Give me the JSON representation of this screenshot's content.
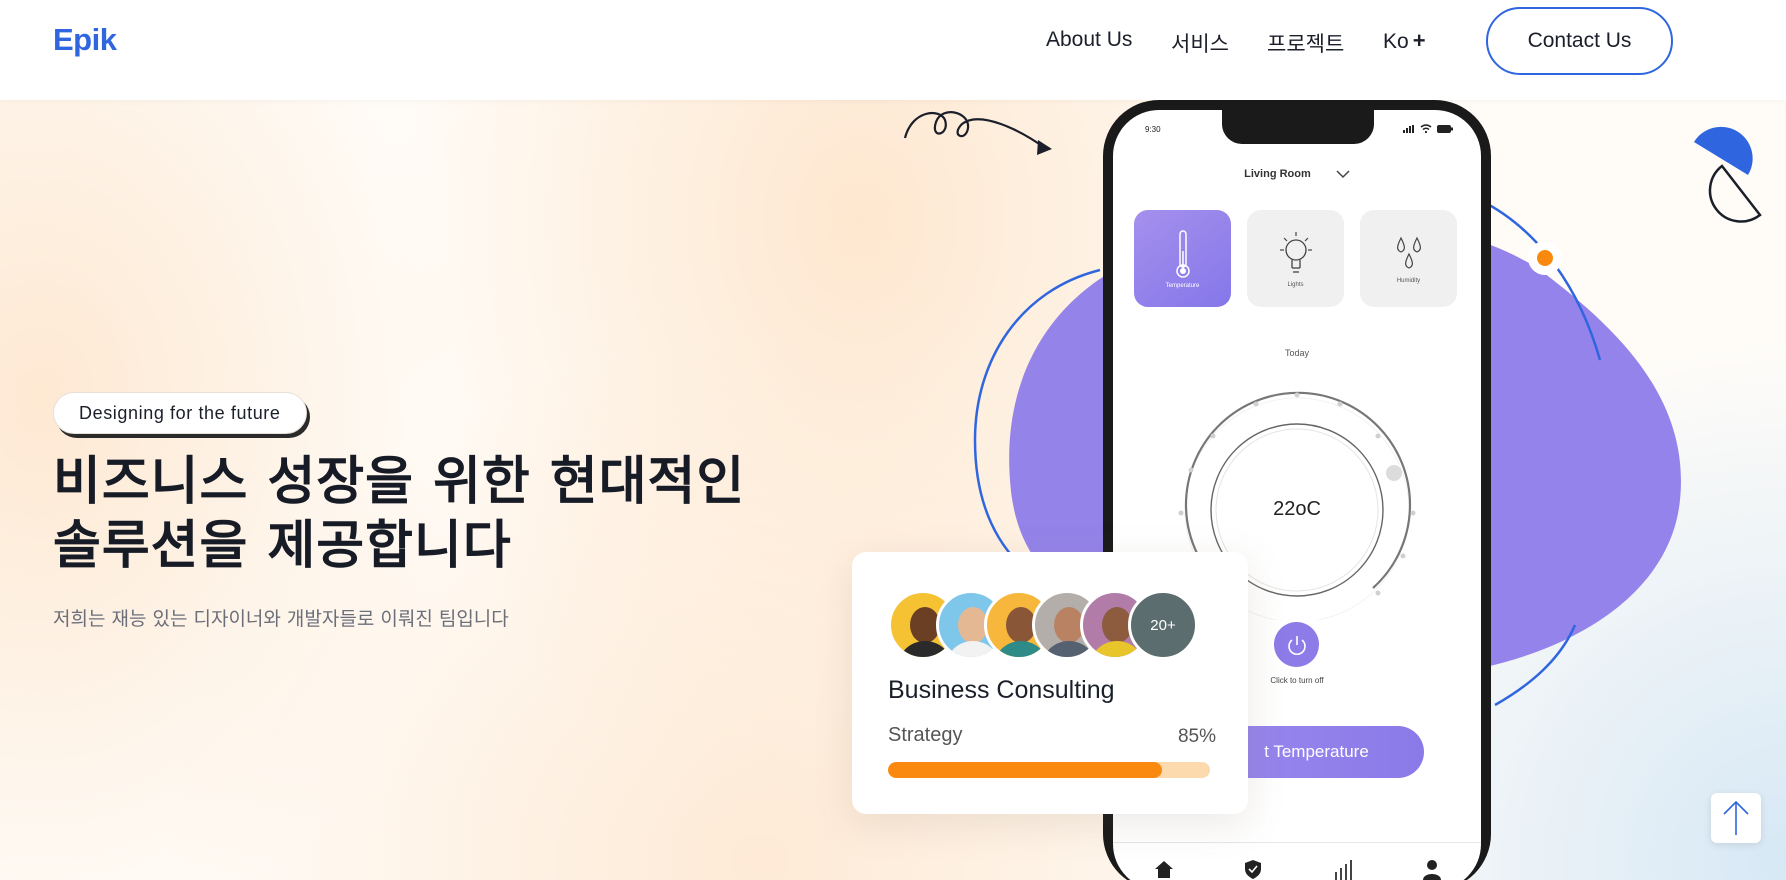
{
  "header": {
    "logo": "Epik",
    "nav": [
      {
        "label": "About Us"
      },
      {
        "label": "서비스"
      },
      {
        "label": "프로젝트"
      },
      {
        "label": "Ko"
      }
    ],
    "lang_plus": "+",
    "contact_label": "Contact Us"
  },
  "hero": {
    "tagline": "Designing for the future",
    "title_line1": "비즈니스 성장을 위한 현대적인",
    "title_line2": "솔루션을 제공합니다",
    "subtitle": "저희는 재능 있는 디자이너와 개발자들로 이뤄진 팀입니다"
  },
  "phone": {
    "status_time": "9:30",
    "room": "Living Room",
    "tiles": [
      {
        "label": "Temperature",
        "icon": "thermometer-icon",
        "active": true
      },
      {
        "label": "Lights",
        "icon": "lightbulb-icon",
        "active": false
      },
      {
        "label": "Humidity",
        "icon": "droplets-icon",
        "active": false
      }
    ],
    "today": "Today",
    "dial_value": "22oC",
    "power_label": "Click to turn off",
    "set_temp_label": "t Temperature"
  },
  "business_card": {
    "more_count": "20+",
    "title": "Business Consulting",
    "metric_label": "Strategy",
    "metric_value": "85%",
    "progress": 0.85
  },
  "colors": {
    "brand_blue": "#2f66e0",
    "purple": "#8577ea",
    "orange": "#fa8a0f"
  }
}
